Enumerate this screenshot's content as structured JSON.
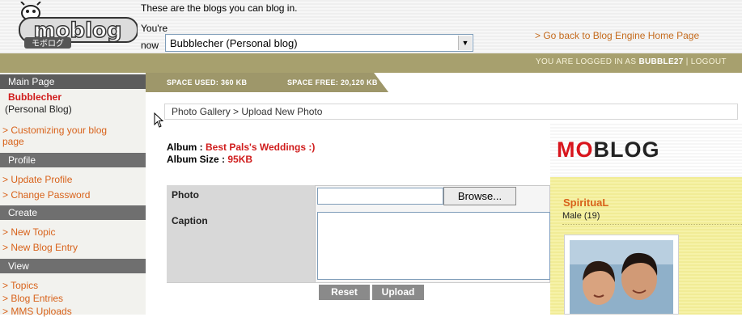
{
  "header": {
    "logo_text": "moblog",
    "logo_subtext": "モボログ",
    "blog_message": "These are the blogs you can blog in.",
    "youre_label": "You're",
    "now_label": "now",
    "selected_blog": "Bubblecher (Personal blog)",
    "home_link": "> Go back to Blog Engine Home Page",
    "logged_in_text": "YOU ARE LOGGED IN AS",
    "username": "BUBBLE27",
    "logout_text": "| LOGOUT"
  },
  "space": {
    "used": "SPACE USED: 360 KB",
    "free": "SPACE FREE: 20,120 KB"
  },
  "sidebar": {
    "main_page": "Main Page",
    "blog_name": "Bubblecher",
    "blog_type": "(Personal Blog)",
    "customize": "> Customizing your blog page",
    "profile_head": "Profile",
    "update_profile": "> Update Profile",
    "change_password": "> Change Password",
    "create_head": "Create",
    "new_topic": "> New Topic",
    "new_blog_entry": "> New Blog Entry",
    "view_head": "View",
    "topics": "> Topics",
    "blog_entries": "> Blog Entries",
    "mms_uploads": "> MMS Uploads"
  },
  "main": {
    "breadcrumb": "Photo Gallery > Upload New Photo",
    "album_label": "Album : ",
    "album_name": "Best Pals's Weddings :)",
    "album_size_label": "Album Size : ",
    "album_size": "95KB",
    "photo_label": "Photo",
    "caption_label": "Caption",
    "browse_label": "Browse...",
    "reset_label": "Reset",
    "upload_label": "Upload"
  },
  "preview": {
    "brand_mo": "MO",
    "brand_rest": "BLOG",
    "profile_name": "SpirituaL",
    "profile_info": "Male  (19)"
  },
  "colors": {
    "accent_orange": "#d8621a",
    "olive": "#a7a06e",
    "alert_red": "#d01c1c",
    "preview_yellow": "#f3ee9d"
  }
}
